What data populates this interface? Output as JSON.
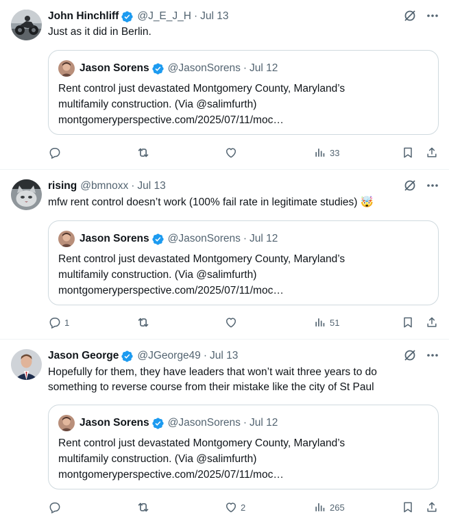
{
  "tweets": [
    {
      "author": {
        "name": "John Hinchliff",
        "handle": "@J_E_J_H",
        "verified": true,
        "avatar_icon": "motorcycle-photo"
      },
      "time": "Jul 13",
      "text": "Just as it did in Berlin.",
      "quote": {
        "author": {
          "name": "Jason Sorens",
          "handle": "@JasonSorens",
          "verified": true
        },
        "time": "Jul 12",
        "text_lines": [
          "Rent control just devastated Montgomery County, Maryland’s",
          "multifamily construction. (Via @salimfurth)",
          "montgomeryperspective.com/2025/07/11/moc…"
        ]
      },
      "stats": {
        "replies": "",
        "reposts": "",
        "likes": "",
        "views": "33"
      }
    },
    {
      "author": {
        "name": "rising",
        "handle": "@bmnoxx",
        "verified": false,
        "avatar_icon": "cat-photo"
      },
      "time": "Jul 13",
      "text": "mfw rent control doesn’t work (100% fail rate in legitimate studies) 🤯",
      "quote": {
        "author": {
          "name": "Jason Sorens",
          "handle": "@JasonSorens",
          "verified": true
        },
        "time": "Jul 12",
        "text_lines": [
          "Rent control just devastated Montgomery County, Maryland’s",
          "multifamily construction. (Via @salimfurth)",
          "montgomeryperspective.com/2025/07/11/moc…"
        ]
      },
      "stats": {
        "replies": "1",
        "reposts": "",
        "likes": "",
        "views": "51"
      }
    },
    {
      "author": {
        "name": "Jason George",
        "handle": "@JGeorge49",
        "verified": true,
        "avatar_icon": "person-photo"
      },
      "time": "Jul 13",
      "text_lines": [
        "Hopefully for them, they have leaders that won’t wait three years to do",
        "something to reverse course from their mistake like the city of St Paul"
      ],
      "quote": {
        "author": {
          "name": "Jason Sorens",
          "handle": "@JasonSorens",
          "verified": true
        },
        "time": "Jul 12",
        "text_lines": [
          "Rent control just devastated Montgomery County, Maryland’s",
          "multifamily construction. (Via @salimfurth)",
          "montgomeryperspective.com/2025/07/11/moc…"
        ]
      },
      "stats": {
        "replies": "",
        "reposts": "",
        "likes": "2",
        "views": "265"
      }
    }
  ],
  "colors": {
    "text": "#0f1419",
    "muted": "#536471",
    "verified": "#1d9bf0",
    "border": "#cfd9de",
    "divider": "#eff3f4"
  },
  "icons": [
    "verified-badge-icon",
    "grok-icon",
    "more-icon",
    "reply-icon",
    "repost-icon",
    "like-icon",
    "views-icon",
    "bookmark-icon",
    "share-icon"
  ]
}
